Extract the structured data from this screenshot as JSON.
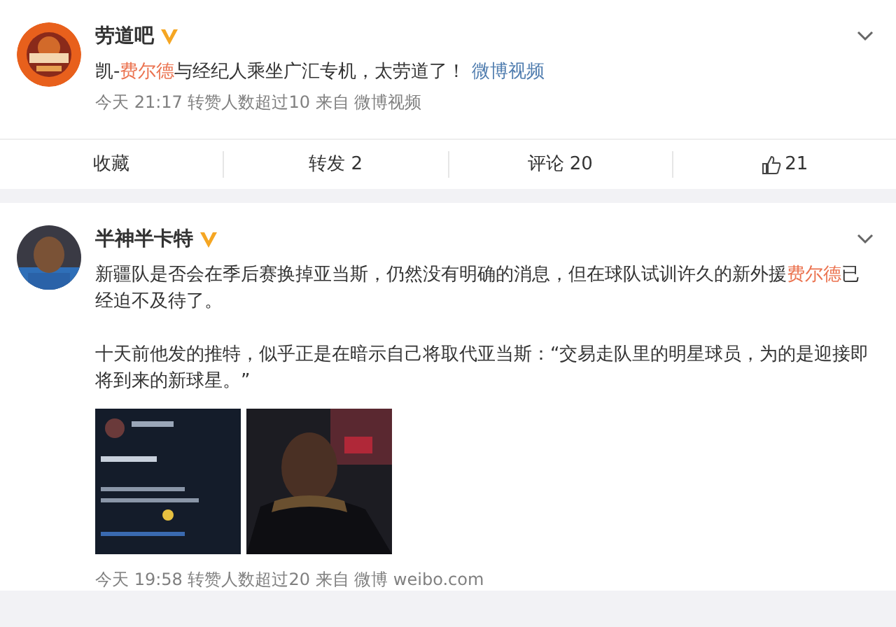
{
  "posts": [
    {
      "author": "劳道吧",
      "verified": true,
      "text": "凯-",
      "mention": "费尔德",
      "text_after": "与经纪人乘坐广汇专机，太劳道了！",
      "link": "微博视频",
      "meta": "今天 21:17 转赞人数超过10 来自 微博视频",
      "actions": [
        {
          "kind": "text",
          "label": "收藏"
        },
        {
          "kind": "text",
          "label": "转发 2"
        },
        {
          "kind": "text",
          "label": "评论 20"
        },
        {
          "kind": "like",
          "label": "21"
        }
      ]
    },
    {
      "author": "半神半卡特",
      "verified": true,
      "text": "新疆队是否会在季后赛换掉亚当斯，仍然没有明确的消息，但在球队试训许久的新外援",
      "mention": "费尔德",
      "text_after": "已经迫不及待了。",
      "paragraphs": [
        "十天前他发的推特，似乎正是在暗示自己将取代亚当斯：“交易走队里的明星球员，为的是迎接即将到来的新球星。”"
      ],
      "images": [
        {
          "kind": "picture"
        },
        {
          "kind": "picture"
        }
      ],
      "meta": "今天 19:58 转赞人数超过20 来自 微博 weibo.com"
    }
  ]
}
